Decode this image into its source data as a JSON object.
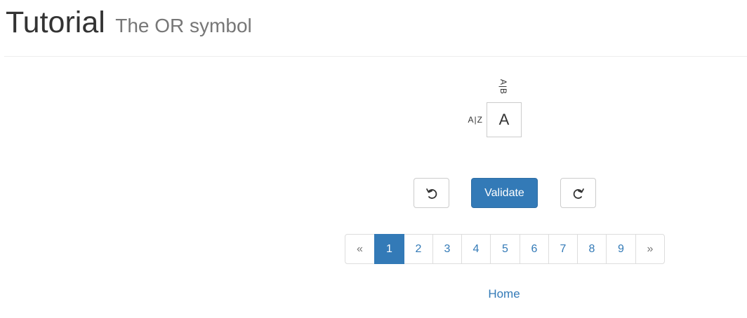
{
  "header": {
    "title": "Tutorial",
    "subtitle": "The OR symbol"
  },
  "puzzle": {
    "column_clue": "A|B",
    "row_clue": "A|Z",
    "cell_value": "A"
  },
  "toolbar": {
    "undo_icon": "undo-icon",
    "validate_label": "Validate",
    "redo_icon": "redo-icon",
    "primary_color": "#337ab7"
  },
  "pagination": {
    "prev_label": "«",
    "pages": [
      "1",
      "2",
      "3",
      "4",
      "5",
      "6",
      "7",
      "8",
      "9"
    ],
    "active_page": "1",
    "next_label": "»"
  },
  "footer": {
    "home_label": "Home"
  }
}
